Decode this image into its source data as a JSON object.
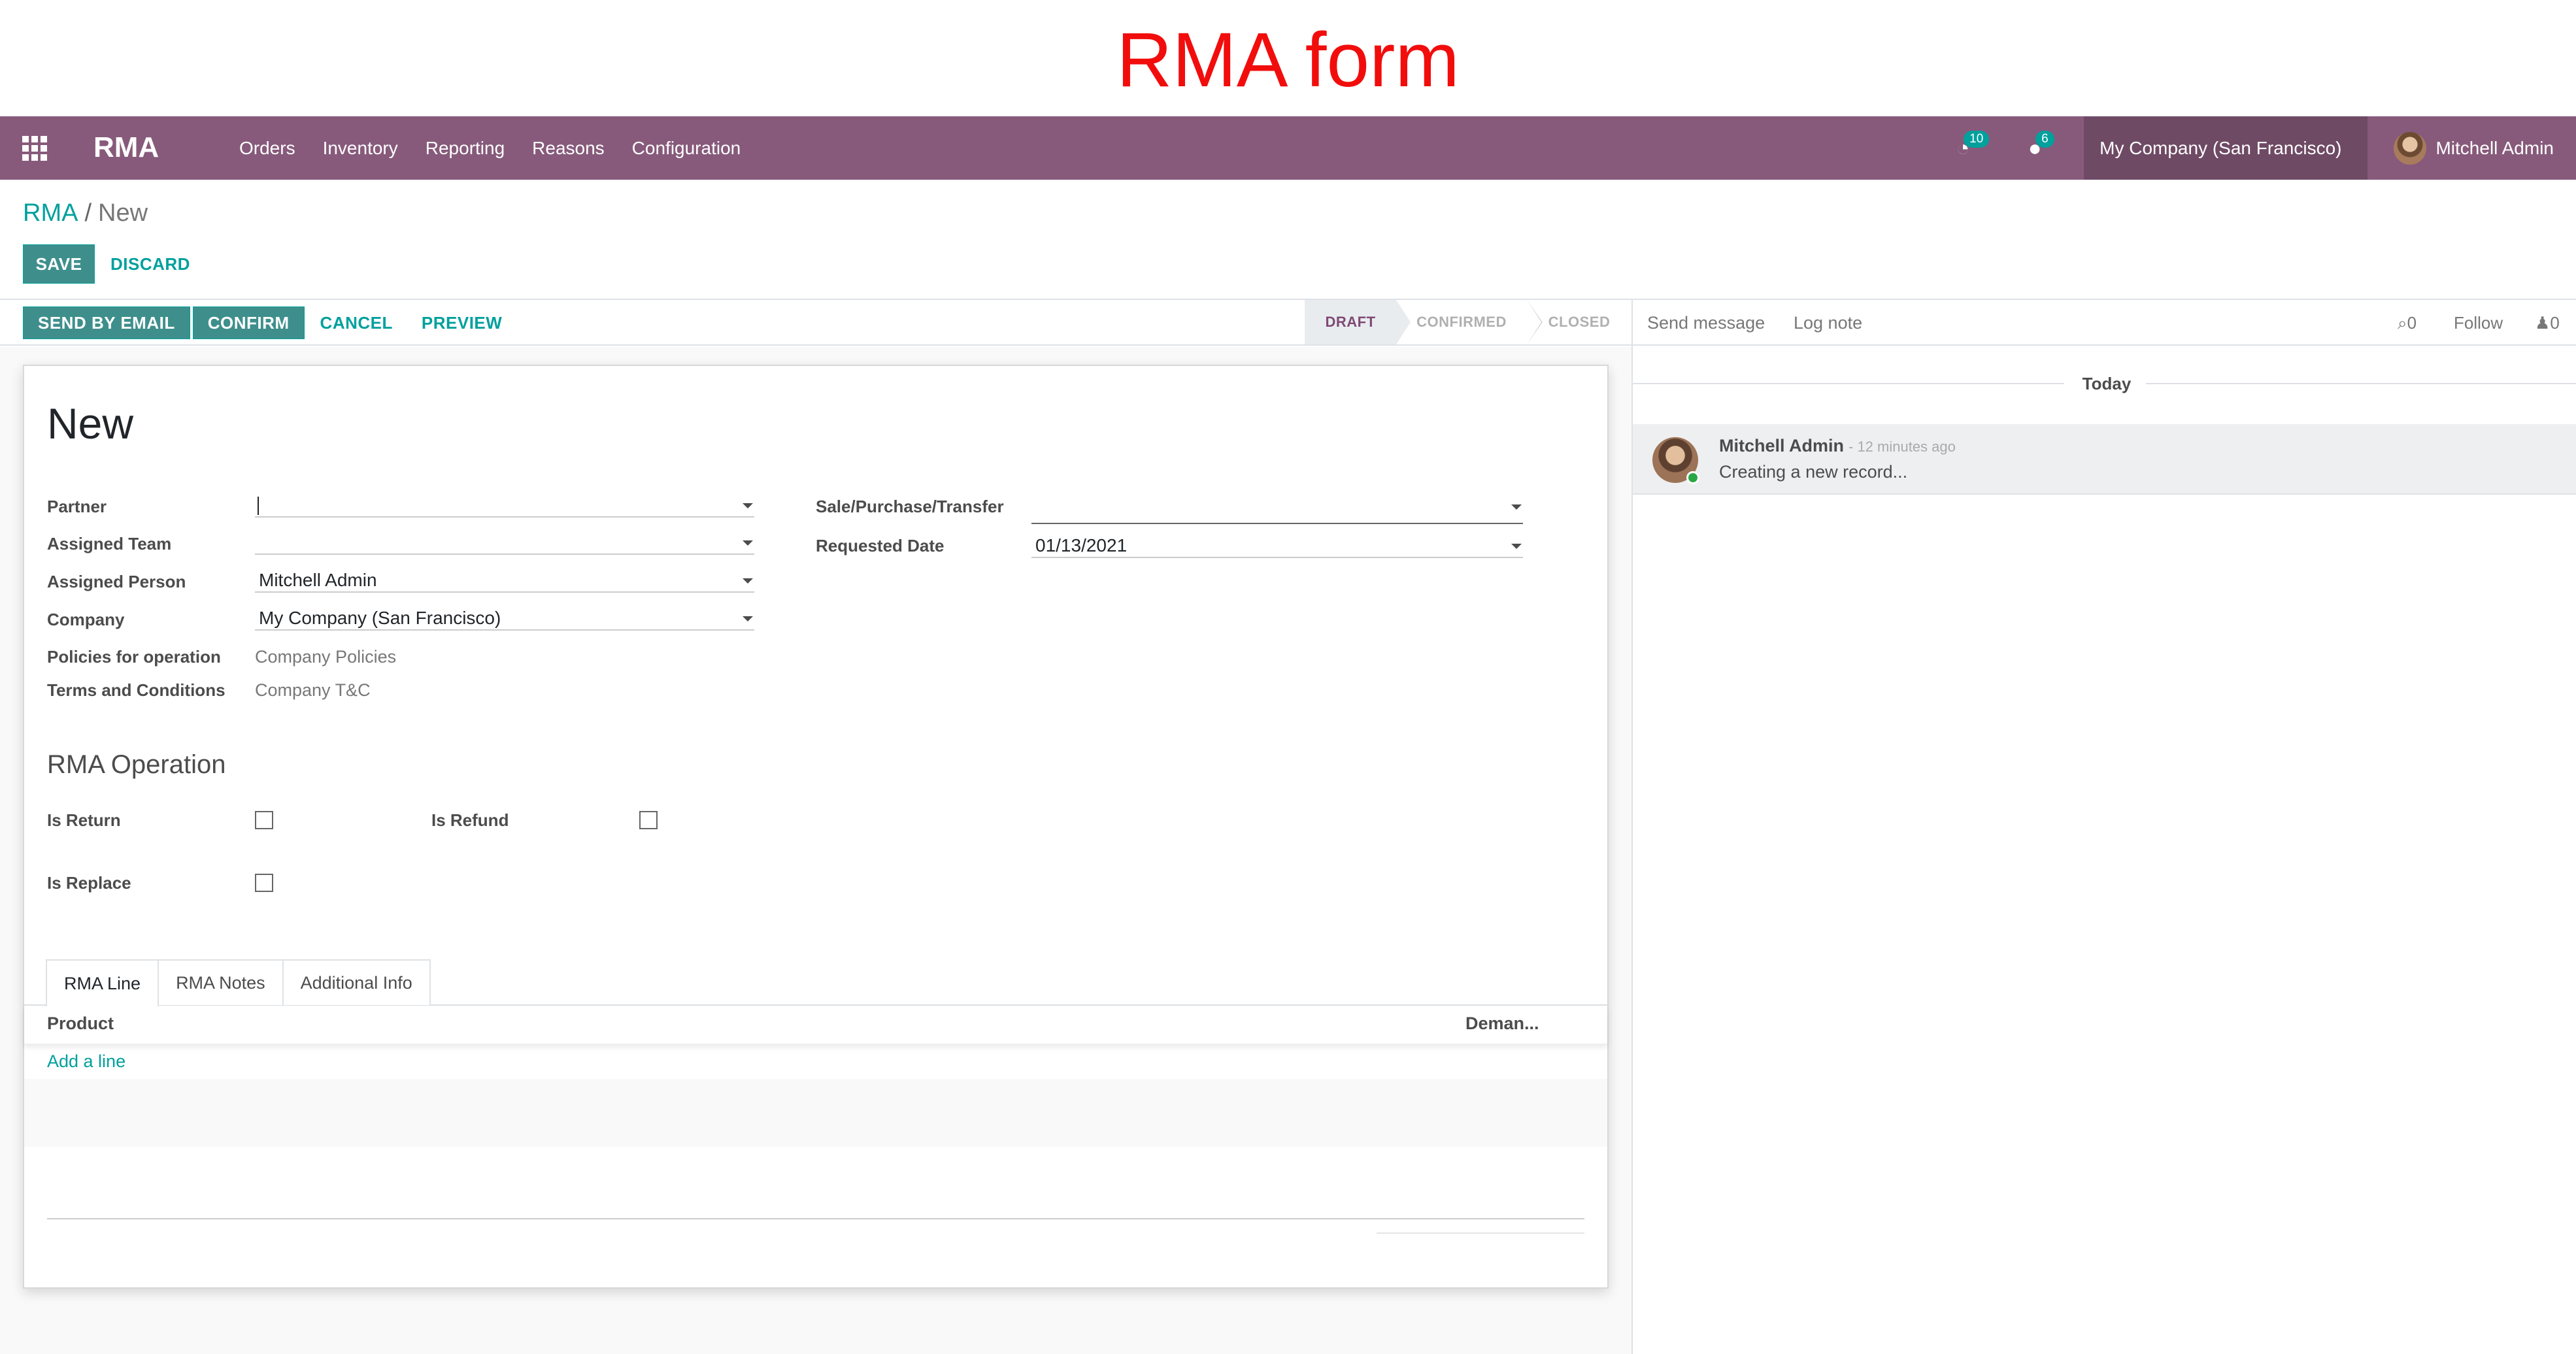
{
  "banner": {
    "title": "RMA form"
  },
  "navbar": {
    "app_name": "RMA",
    "menu": [
      "Orders",
      "Inventory",
      "Reporting",
      "Reasons",
      "Configuration"
    ],
    "activity_count": "10",
    "message_count": "6",
    "company": "My Company (San Francisco)",
    "user": "Mitchell Admin"
  },
  "breadcrumb": {
    "root": "RMA",
    "separator": "/",
    "current": "New"
  },
  "actions": {
    "save": "SAVE",
    "discard": "DISCARD"
  },
  "statusbar": {
    "buttons": [
      "SEND BY EMAIL",
      "CONFIRM",
      "CANCEL",
      "PREVIEW"
    ],
    "stages": [
      "DRAFT",
      "CONFIRMED",
      "CLOSED"
    ],
    "active_stage": "DRAFT"
  },
  "form": {
    "title": "New",
    "fields": {
      "partner": {
        "label": "Partner",
        "value": ""
      },
      "assigned_team": {
        "label": "Assigned Team",
        "value": ""
      },
      "assigned_person": {
        "label": "Assigned Person",
        "value": "Mitchell Admin"
      },
      "company": {
        "label": "Company",
        "value": "My Company (San Francisco)"
      },
      "policies": {
        "label": "Policies for operation",
        "value": "Company Policies"
      },
      "terms": {
        "label": "Terms and Conditions",
        "value": "Company T&C"
      },
      "sale_purchase_transfer": {
        "label": "Sale/Purchase/Transfer",
        "value": ""
      },
      "requested_date": {
        "label": "Requested Date",
        "value": "01/13/2021"
      }
    },
    "operation": {
      "title": "RMA Operation",
      "is_return": {
        "label": "Is Return",
        "checked": false
      },
      "is_refund": {
        "label": "Is Refund",
        "checked": false
      },
      "is_replace": {
        "label": "Is Replace",
        "checked": false
      }
    },
    "tabs": [
      "RMA Line",
      "RMA Notes",
      "Additional Info"
    ],
    "active_tab": "RMA Line",
    "lines_table": {
      "columns": [
        "Product",
        "Deman..."
      ],
      "add_line": "Add a line"
    }
  },
  "chatter": {
    "send_message": "Send message",
    "log_note": "Log note",
    "attachments_count": "0",
    "follow": "Follow",
    "followers_count": "0",
    "date_separator": "Today",
    "messages": [
      {
        "author": "Mitchell Admin",
        "date": "- 12 minutes ago",
        "body": "Creating a new record..."
      }
    ]
  },
  "colors": {
    "brand": "#875a7b",
    "accent": "#00a09d",
    "banner_title": "#f20d0d"
  }
}
